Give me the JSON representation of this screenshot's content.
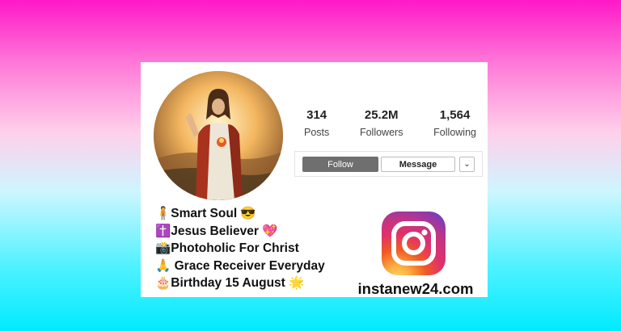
{
  "profile": {
    "stats": [
      {
        "value": "314",
        "label": "Posts"
      },
      {
        "value": "25.2M",
        "label": "Followers"
      },
      {
        "value": "1,564",
        "label": "Following"
      }
    ],
    "buttons": {
      "follow": "Follow",
      "message": "Message",
      "more": "⌄"
    },
    "bio": [
      "🧍Smart Soul 😎",
      "✝️Jesus Believer 💖",
      "📸Photoholic For Christ",
      "🙏 Grace Receiver Everyday",
      "🎂Birthday 15 August 🌟"
    ]
  },
  "branding": {
    "logo_icon": "instagram-icon",
    "site": "instanew24.com"
  },
  "colors": {
    "follow_button": "#6f6f6f",
    "page_top": "#ff18c8",
    "page_bottom": "#00ebff"
  }
}
